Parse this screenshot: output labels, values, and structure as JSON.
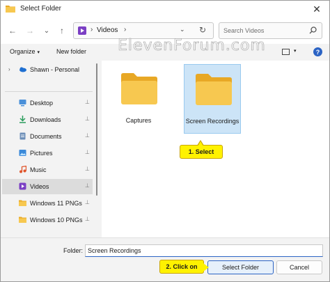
{
  "window": {
    "title": "Select Folder",
    "close_glyph": "✕"
  },
  "address": {
    "path": "Videos",
    "separator": "›",
    "dropdown_glyph": "⌄",
    "refresh_glyph": "↻",
    "icon": "videos-library-icon"
  },
  "nav": {
    "back": "←",
    "forward": "→",
    "recent": "⌄",
    "up": "↑"
  },
  "search": {
    "placeholder": "Search Videos",
    "icon": "search-icon"
  },
  "command_bar": {
    "organize": "Organize",
    "new_folder": "New folder",
    "caret": "▾",
    "help": "?"
  },
  "watermark": "ElevenForum.com",
  "sidebar": {
    "items": [
      {
        "label": "Shawn - Personal",
        "icon": "onedrive-cloud-icon",
        "pinned": false
      },
      {
        "label": "Desktop",
        "icon": "desktop-icon",
        "pinned": true
      },
      {
        "label": "Downloads",
        "icon": "download-icon",
        "pinned": true
      },
      {
        "label": "Documents",
        "icon": "documents-icon",
        "pinned": true
      },
      {
        "label": "Pictures",
        "icon": "pictures-icon",
        "pinned": true
      },
      {
        "label": "Music",
        "icon": "music-icon",
        "pinned": true
      },
      {
        "label": "Videos",
        "icon": "videos-icon",
        "pinned": true,
        "selected": true
      },
      {
        "label": "Windows 11 PNGs",
        "icon": "folder-icon",
        "pinned": true
      },
      {
        "label": "Windows 10 PNGs",
        "icon": "folder-icon",
        "pinned": true
      }
    ],
    "pin_glyph": "📌",
    "chevron": "›"
  },
  "content": {
    "folders": [
      {
        "name": "Captures",
        "selected": false
      },
      {
        "name": "Screen Recordings",
        "selected": true
      }
    ]
  },
  "callouts": {
    "step1": "1. Select",
    "step2": "2. Click on"
  },
  "footer": {
    "folder_label": "Folder:",
    "folder_value": "Screen Recordings",
    "select_button": "Select Folder",
    "cancel_button": "Cancel"
  },
  "colors": {
    "accent": "#2b63c4",
    "folder": "#f7c850",
    "selection": "#cce4f7",
    "callout": "#fff200"
  }
}
